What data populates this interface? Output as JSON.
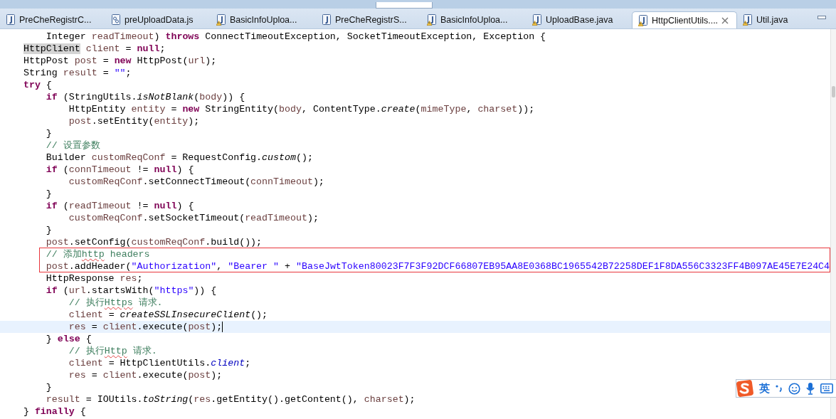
{
  "editor_tabs": [
    {
      "label": "PreCheRegistrC...",
      "kind": "java",
      "warning": false,
      "selected": false
    },
    {
      "label": "preUploadData.js",
      "kind": "js",
      "warning": false,
      "selected": false
    },
    {
      "label": "BasicInfoUploa...",
      "kind": "java",
      "warning": true,
      "selected": false
    },
    {
      "label": "PreCheRegistrS...",
      "kind": "java",
      "warning": false,
      "selected": false
    },
    {
      "label": "BasicInfoUploa...",
      "kind": "java",
      "warning": true,
      "selected": false
    },
    {
      "label": "UploadBase.java",
      "kind": "java",
      "warning": true,
      "selected": false
    },
    {
      "label": "HttpClientUtils....",
      "kind": "java",
      "warning": true,
      "selected": true
    },
    {
      "label": "Util.java",
      "kind": "java",
      "warning": true,
      "selected": false
    }
  ],
  "code_lines": [
    {
      "tokens": [
        {
          "kind": "plain",
          "text": "        Integer "
        },
        {
          "kind": "var",
          "text": "readTimeout"
        },
        {
          "kind": "plain",
          "text": ") "
        },
        {
          "kind": "kw",
          "text": "throws"
        },
        {
          "kind": "plain",
          "text": " ConnectTimeoutException, SocketTimeoutException, Exception {"
        }
      ]
    },
    {
      "tokens": [
        {
          "kind": "occurrence",
          "text": "    HttpClient"
        },
        {
          "kind": "var",
          "text": " client"
        },
        {
          "kind": "plain",
          "text": " = "
        },
        {
          "kind": "kw",
          "text": "null"
        },
        {
          "kind": "plain",
          "text": ";"
        }
      ]
    },
    {
      "tokens": [
        {
          "kind": "plain",
          "text": "    HttpPost "
        },
        {
          "kind": "var",
          "text": "post"
        },
        {
          "kind": "plain",
          "text": " = "
        },
        {
          "kind": "kw",
          "text": "new"
        },
        {
          "kind": "plain",
          "text": " HttpPost("
        },
        {
          "kind": "var",
          "text": "url"
        },
        {
          "kind": "plain",
          "text": ");"
        }
      ]
    },
    {
      "tokens": [
        {
          "kind": "plain",
          "text": "    String "
        },
        {
          "kind": "var",
          "text": "result"
        },
        {
          "kind": "plain",
          "text": " = "
        },
        {
          "kind": "str",
          "text": "\"\""
        },
        {
          "kind": "plain",
          "text": ";"
        }
      ]
    },
    {
      "tokens": [
        {
          "kind": "kw",
          "text": "    try"
        },
        {
          "kind": "plain",
          "text": " {"
        }
      ]
    },
    {
      "tokens": [
        {
          "kind": "kw",
          "text": "        if"
        },
        {
          "kind": "plain",
          "text": " (StringUtils."
        },
        {
          "kind": "static",
          "text": "isNotBlank"
        },
        {
          "kind": "plain",
          "text": "("
        },
        {
          "kind": "var",
          "text": "body"
        },
        {
          "kind": "plain",
          "text": ")) {"
        }
      ]
    },
    {
      "tokens": [
        {
          "kind": "plain",
          "text": "            HttpEntity "
        },
        {
          "kind": "var",
          "text": "entity"
        },
        {
          "kind": "plain",
          "text": " = "
        },
        {
          "kind": "kw",
          "text": "new"
        },
        {
          "kind": "plain",
          "text": " StringEntity("
        },
        {
          "kind": "var",
          "text": "body"
        },
        {
          "kind": "plain",
          "text": ", ContentType."
        },
        {
          "kind": "static",
          "text": "create"
        },
        {
          "kind": "plain",
          "text": "("
        },
        {
          "kind": "var",
          "text": "mimeType"
        },
        {
          "kind": "plain",
          "text": ", "
        },
        {
          "kind": "var",
          "text": "charset"
        },
        {
          "kind": "plain",
          "text": "));"
        }
      ]
    },
    {
      "tokens": [
        {
          "kind": "var",
          "text": "            post"
        },
        {
          "kind": "plain",
          "text": ".setEntity("
        },
        {
          "kind": "var",
          "text": "entity"
        },
        {
          "kind": "plain",
          "text": ");"
        }
      ]
    },
    {
      "tokens": [
        {
          "kind": "plain",
          "text": "        }"
        }
      ]
    },
    {
      "tokens": [
        {
          "kind": "comment",
          "text": "        // 设置参数"
        }
      ]
    },
    {
      "tokens": [
        {
          "kind": "plain",
          "text": "        Builder "
        },
        {
          "kind": "var",
          "text": "customReqConf"
        },
        {
          "kind": "plain",
          "text": " = RequestConfig."
        },
        {
          "kind": "static",
          "text": "custom"
        },
        {
          "kind": "plain",
          "text": "();"
        }
      ]
    },
    {
      "tokens": [
        {
          "kind": "kw",
          "text": "        if"
        },
        {
          "kind": "plain",
          "text": " ("
        },
        {
          "kind": "var",
          "text": "connTimeout"
        },
        {
          "kind": "plain",
          "text": " != "
        },
        {
          "kind": "kw",
          "text": "null"
        },
        {
          "kind": "plain",
          "text": ") {"
        }
      ]
    },
    {
      "tokens": [
        {
          "kind": "var",
          "text": "            customReqConf"
        },
        {
          "kind": "plain",
          "text": ".setConnectTimeout("
        },
        {
          "kind": "var",
          "text": "connTimeout"
        },
        {
          "kind": "plain",
          "text": ");"
        }
      ]
    },
    {
      "tokens": [
        {
          "kind": "plain",
          "text": "        }"
        }
      ]
    },
    {
      "tokens": [
        {
          "kind": "kw",
          "text": "        if"
        },
        {
          "kind": "plain",
          "text": " ("
        },
        {
          "kind": "var",
          "text": "readTimeout"
        },
        {
          "kind": "plain",
          "text": " != "
        },
        {
          "kind": "kw",
          "text": "null"
        },
        {
          "kind": "plain",
          "text": ") {"
        }
      ]
    },
    {
      "tokens": [
        {
          "kind": "var",
          "text": "            customReqConf"
        },
        {
          "kind": "plain",
          "text": ".setSocketTimeout("
        },
        {
          "kind": "var",
          "text": "readTimeout"
        },
        {
          "kind": "plain",
          "text": ");"
        }
      ]
    },
    {
      "tokens": [
        {
          "kind": "plain",
          "text": "        }"
        }
      ]
    },
    {
      "tokens": [
        {
          "kind": "var",
          "text": "        post"
        },
        {
          "kind": "plain",
          "text": ".setConfig("
        },
        {
          "kind": "var",
          "text": "customReqConf"
        },
        {
          "kind": "plain",
          "text": ".build());"
        }
      ]
    },
    {
      "boxed": true,
      "tokens": [
        {
          "kind": "comment",
          "text": "        // 添加"
        },
        {
          "kind": "misspelled",
          "text": "http"
        },
        {
          "kind": "comment",
          "text": " headers"
        }
      ]
    },
    {
      "boxed": true,
      "tokens": [
        {
          "kind": "var",
          "text": "        post"
        },
        {
          "kind": "plain",
          "text": ".addHeader("
        },
        {
          "kind": "str",
          "text": "\"Authorization\""
        },
        {
          "kind": "plain",
          "text": ", "
        },
        {
          "kind": "str",
          "text": "\"Bearer \""
        },
        {
          "kind": "plain",
          "text": " + "
        },
        {
          "kind": "str",
          "text": "\"BaseJwtToken80023F7F3F92DCF66807EB95AA8E0368BC1965542B72258DEF1F8DA556C3323FF4B097AE45E7E24C4"
        }
      ]
    },
    {
      "tokens": [
        {
          "kind": "plain",
          "text": "        HttpResponse "
        },
        {
          "kind": "var",
          "text": "res"
        },
        {
          "kind": "plain",
          "text": ";"
        }
      ]
    },
    {
      "tokens": [
        {
          "kind": "kw",
          "text": "        if"
        },
        {
          "kind": "plain",
          "text": " ("
        },
        {
          "kind": "var",
          "text": "url"
        },
        {
          "kind": "plain",
          "text": ".startsWith("
        },
        {
          "kind": "str",
          "text": "\"https\""
        },
        {
          "kind": "plain",
          "text": ")) {"
        }
      ]
    },
    {
      "tokens": [
        {
          "kind": "comment",
          "text": "            // 执行"
        },
        {
          "kind": "misspelled",
          "text": "Https"
        },
        {
          "kind": "comment",
          "text": " 请求."
        }
      ]
    },
    {
      "tokens": [
        {
          "kind": "var",
          "text": "            client"
        },
        {
          "kind": "plain",
          "text": " = "
        },
        {
          "kind": "static",
          "text": "createSSLInsecureClient"
        },
        {
          "kind": "plain",
          "text": "();"
        }
      ]
    },
    {
      "current": true,
      "tokens": [
        {
          "kind": "var",
          "text": "            res"
        },
        {
          "kind": "plain",
          "text": " = "
        },
        {
          "kind": "var",
          "text": "client"
        },
        {
          "kind": "plain",
          "text": ".execute("
        },
        {
          "kind": "var",
          "text": "post"
        },
        {
          "kind": "plain",
          "text": ");"
        }
      ]
    },
    {
      "tokens": [
        {
          "kind": "plain",
          "text": "        } "
        },
        {
          "kind": "kw",
          "text": "else"
        },
        {
          "kind": "plain",
          "text": " {"
        }
      ]
    },
    {
      "tokens": [
        {
          "kind": "comment",
          "text": "            // 执行"
        },
        {
          "kind": "misspelled",
          "text": "Http"
        },
        {
          "kind": "comment",
          "text": " 请求."
        }
      ]
    },
    {
      "tokens": [
        {
          "kind": "var",
          "text": "            client"
        },
        {
          "kind": "plain",
          "text": " = HttpClientUtils."
        },
        {
          "kind": "field",
          "text": "client"
        },
        {
          "kind": "plain",
          "text": ";"
        }
      ]
    },
    {
      "tokens": [
        {
          "kind": "var",
          "text": "            res"
        },
        {
          "kind": "plain",
          "text": " = "
        },
        {
          "kind": "var",
          "text": "client"
        },
        {
          "kind": "plain",
          "text": ".execute("
        },
        {
          "kind": "var",
          "text": "post"
        },
        {
          "kind": "plain",
          "text": ");"
        }
      ]
    },
    {
      "tokens": [
        {
          "kind": "plain",
          "text": "        }"
        }
      ]
    },
    {
      "tokens": [
        {
          "kind": "var",
          "text": "        result"
        },
        {
          "kind": "plain",
          "text": " = IOUtils."
        },
        {
          "kind": "static",
          "text": "toString"
        },
        {
          "kind": "plain",
          "text": "("
        },
        {
          "kind": "var",
          "text": "res"
        },
        {
          "kind": "plain",
          "text": ".getEntity().getContent(), "
        },
        {
          "kind": "var",
          "text": "charset"
        },
        {
          "kind": "plain",
          "text": ");"
        }
      ]
    },
    {
      "tokens": [
        {
          "kind": "plain",
          "text": "    } "
        },
        {
          "kind": "kw",
          "text": "finally"
        },
        {
          "kind": "plain",
          "text": " {"
        }
      ]
    }
  ],
  "ime_bar": {
    "language": "英"
  }
}
